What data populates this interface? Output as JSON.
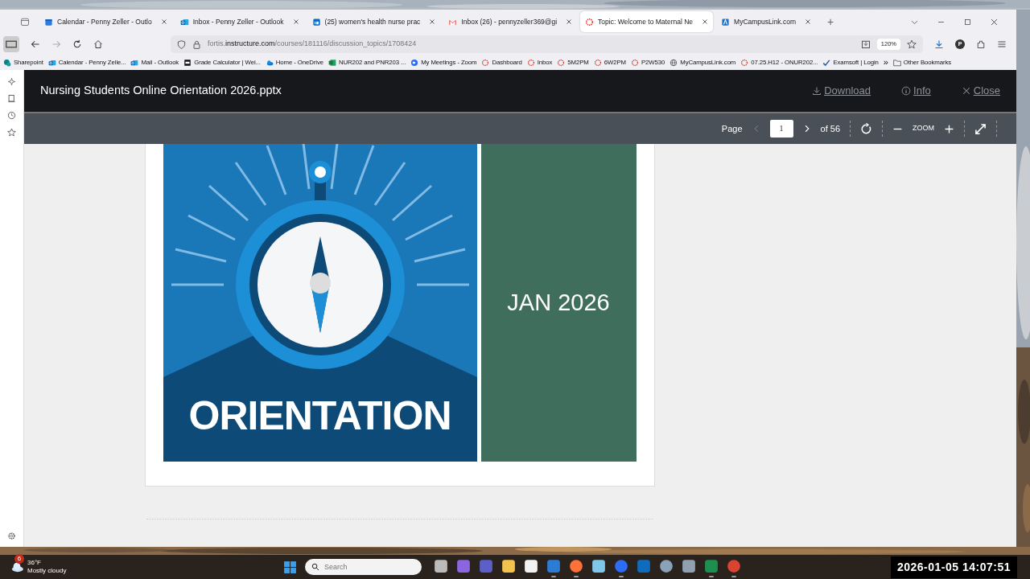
{
  "browser": {
    "tabs": [
      {
        "label": "Calendar - Penny Zeller - Outlo",
        "selected": false
      },
      {
        "label": "Inbox - Penny Zeller - Outlook",
        "selected": false
      },
      {
        "label": "(25) women's health nurse prac",
        "selected": false
      },
      {
        "label": "Inbox (26) - pennyzeller369@gi",
        "selected": false
      },
      {
        "label": "Topic: Welcome to Maternal Ne",
        "selected": true
      },
      {
        "label": "MyCampusLink.com",
        "selected": false
      }
    ],
    "new_tab": "+",
    "address": {
      "host_prefix": "fortis.",
      "host": "instructure.com",
      "path": "/courses/181116/discussion_topics/1708424"
    },
    "zoom": "120%",
    "profile": "P",
    "bookmarks": [
      "Sharepoint",
      "Calendar - Penny Zelle...",
      "Mail - Outlook",
      "Grade Calculator | Wei...",
      "Home - OneDrive",
      "NUR202 and PNR203 ...",
      "My Meetings - Zoom",
      "Dashboard",
      "Inbox",
      "5M2PM",
      "6W2PM",
      "P2W530",
      "MyCampusLink.com",
      "07.25.H12 - ONUR202...",
      "Examsoft | Login"
    ],
    "bookmarks_more": "»",
    "other_bookmarks": "Other Bookmarks"
  },
  "viewer": {
    "title": "Nursing Students Online Orientation 2026.pptx",
    "actions": [
      "Download",
      "Info",
      "Close"
    ],
    "page_label": "Page",
    "page": "1",
    "page_total": "of 56",
    "zoom_label": "ZOOM",
    "slide": {
      "banner": "ORIENTATION",
      "side_text": "JAN 2026"
    }
  },
  "taskbar": {
    "weather": {
      "badge": "6",
      "temperature": "36°F",
      "condition": "Mostly cloudy"
    },
    "search_placeholder": "Search",
    "apps": [
      {
        "running": false
      },
      {
        "running": false
      },
      {
        "running": false
      },
      {
        "running": false
      },
      {
        "running": false
      },
      {
        "running": true
      },
      {
        "running": true
      },
      {
        "running": false
      },
      {
        "running": true
      },
      {
        "running": false
      },
      {
        "running": false
      },
      {
        "running": false
      },
      {
        "running": true
      },
      {
        "running": true
      }
    ]
  },
  "recording_timestamp": "2026-01-05  14:07:51"
}
